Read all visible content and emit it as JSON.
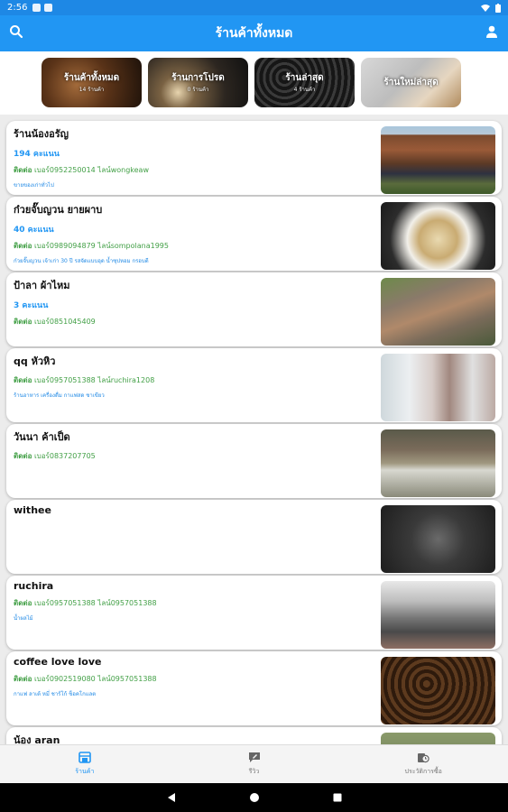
{
  "status": {
    "time": "2:56"
  },
  "appbar": {
    "title": "ร้านค้าทั้งหมด",
    "search_icon": "search-icon",
    "account_icon": "person-icon",
    "color": "#2196f3"
  },
  "categories": [
    {
      "label": "ร้านค้าทั้งหมด",
      "sub": "14 ร้านค้า"
    },
    {
      "label": "ร้านการโปรด",
      "sub": "0 ร้านค้า"
    },
    {
      "label": "ร้านล่าสุด",
      "sub": "4 ร้านค้า"
    },
    {
      "label": "ร้านใหม่ล่าสุด",
      "sub": ""
    }
  ],
  "shops": [
    {
      "name": "ร้านน้องอรัญ",
      "likes": "194 คะแนน",
      "contact_label": "ติดต่อ",
      "contact": "เบอร์0952250014 ไลน์wongkeaw",
      "desc": "ขายของเก่าทั่วไป"
    },
    {
      "name": "ก๋วยจั๊บญวน ยายผาบ",
      "likes": "40 คะแนน",
      "contact_label": "ติดต่อ",
      "contact": "เบอร์0989094879 ไลน์sompolana1995",
      "desc": "ก๋วยจั๊บญวน เจ้าเก่า 30 ปี รสจัดแบบอุด น้ำซุปหอม กรอบดี"
    },
    {
      "name": "ป้าลา ผ้าไหม",
      "likes": "3 คะแนน",
      "contact_label": "ติดต่อ",
      "contact": "เบอร์0851045409",
      "desc": ""
    },
    {
      "name": "qq หัวหิว",
      "likes": "",
      "contact_label": "ติดต่อ",
      "contact": "เบอร์0957051388 ไลน์ruchira1208",
      "desc": "ร้านอาหาร เครื่องดื่ม กาแฟสด ชาเขียว"
    },
    {
      "name": "วันนา ค้าเป็ด",
      "likes": "",
      "contact_label": "ติดต่อ",
      "contact": "เบอร์0837207705",
      "desc": ""
    },
    {
      "name": "withee",
      "likes": "",
      "contact_label": "",
      "contact": "",
      "desc": ""
    },
    {
      "name": "ruchira",
      "likes": "",
      "contact_label": "ติดต่อ",
      "contact": "เบอร์0957051388 ไลน์0957051388",
      "desc": "น้ำผลไม้"
    },
    {
      "name": "coffee love love",
      "likes": "",
      "contact_label": "ติดต่อ",
      "contact": "เบอร์0902519080 ไลน์0957051388",
      "desc": "กาแฟ ลาเต้ หมี่ ชาร์โก้ ช็อคโกแลต"
    },
    {
      "name": "น้อง aran",
      "likes": "",
      "contact_label": "",
      "contact": "",
      "desc": ""
    }
  ],
  "bottom_nav": [
    {
      "label": "ร้านค้า",
      "icon": "store-icon"
    },
    {
      "label": "รีวิว",
      "icon": "review-icon"
    },
    {
      "label": "ประวัติการซื้อ",
      "icon": "history-icon"
    }
  ]
}
